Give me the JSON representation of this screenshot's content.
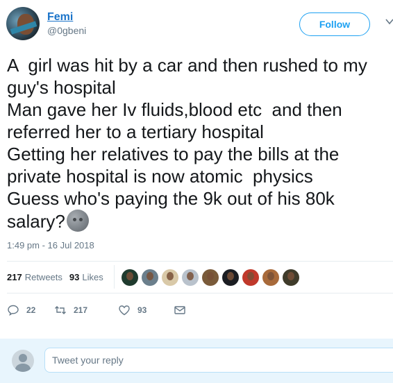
{
  "author": {
    "display_name": "Femi",
    "handle": "@0gbeni"
  },
  "follow_label": "Follow",
  "tweet": {
    "lines": [
      "A  girl was hit by a car and then rushed to my",
      "guy's hospital",
      "Man gave her Iv fluids,blood etc  and then",
      "referred her to a tertiary hospital",
      "Getting her relatives to pay the bills at the",
      "private hospital is now atomic  physics",
      "Guess who's paying the 9k out of his 80k",
      "salary?"
    ],
    "emoji": "new-moon-face-emoji",
    "timestamp": "1:49 pm - 16 Jul 2018"
  },
  "stats": {
    "retweets_count": "217",
    "retweets_label": "Retweets",
    "likes_count": "93",
    "likes_label": "Likes"
  },
  "liker_avatar_colors": [
    "#1f3b2e",
    "#6b7f8c",
    "#d9c9a8",
    "#b9c2cc",
    "#7a5b3a",
    "#1b1d22",
    "#c0392b",
    "#a86a3a",
    "#3f3b2a"
  ],
  "actions": {
    "reply_count": "22",
    "retweet_count": "217",
    "like_count": "93"
  },
  "reply_box": {
    "placeholder": "Tweet your reply"
  },
  "colors": {
    "accent": "#1da1f2",
    "name_link": "#1a73c9",
    "muted": "#657786"
  }
}
